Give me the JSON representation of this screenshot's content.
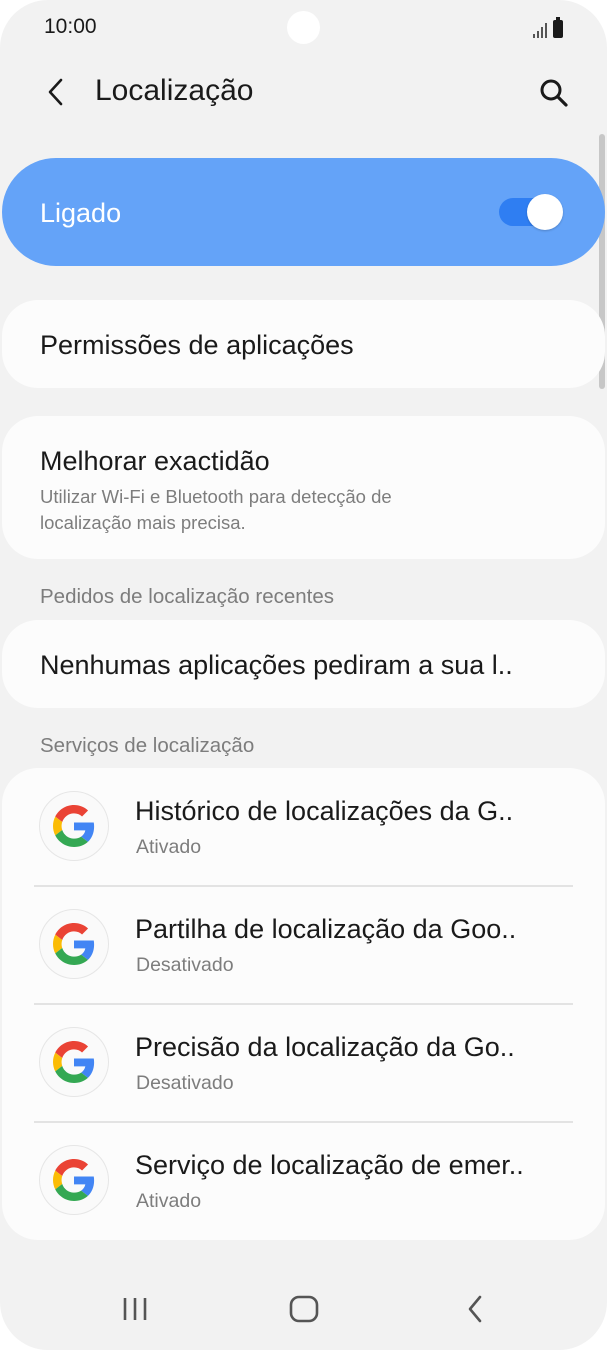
{
  "status_bar": {
    "time": "10:00"
  },
  "header": {
    "title": "Localização"
  },
  "master": {
    "label": "Ligado",
    "enabled": true,
    "accent": "#64a3f8"
  },
  "items": {
    "permissions": {
      "title": "Permissões de aplicações"
    },
    "accuracy": {
      "title": "Melhorar exactidão",
      "subtitle_line1": "Utilizar Wi-Fi e Bluetooth para detecção de",
      "subtitle_line2": "localização mais precisa."
    }
  },
  "recent": {
    "header": "Pedidos de localização recentes",
    "empty_text": "Nenhumas aplicações pediram a sua l.."
  },
  "services": {
    "header": "Serviços de localização",
    "items": [
      {
        "title": "Histórico de localizações da G..",
        "status": "Ativado",
        "icon": "google-icon"
      },
      {
        "title": "Partilha de localização da Goo..",
        "status": "Desativado",
        "icon": "google-icon"
      },
      {
        "title": "Precisão da localização da Go..",
        "status": "Desativado",
        "icon": "google-icon"
      },
      {
        "title": "Serviço de localização de emer..",
        "status": "Ativado",
        "icon": "google-icon"
      }
    ]
  },
  "nav": {
    "recents": "recents-icon",
    "home": "home-icon",
    "back": "back-icon"
  }
}
